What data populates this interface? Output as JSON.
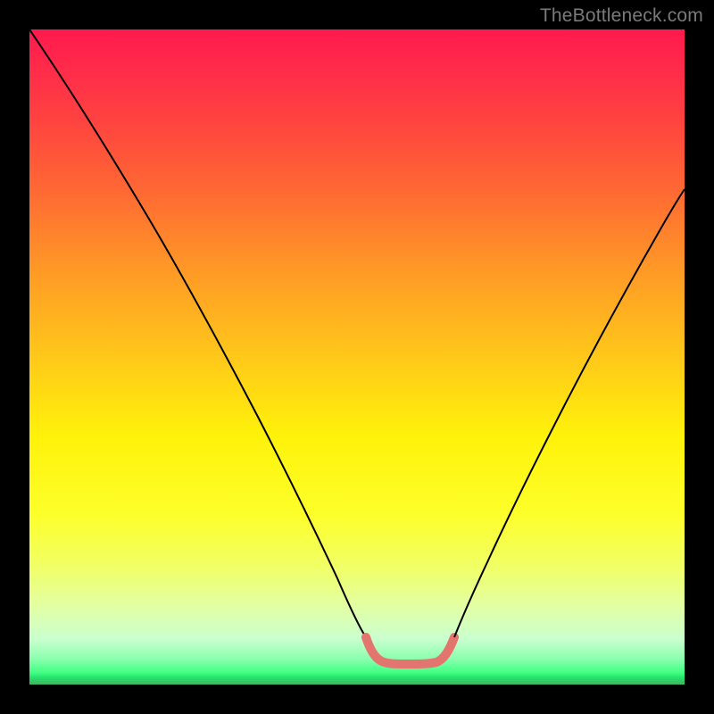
{
  "watermark": "TheBottleneck.com",
  "chart_data": {
    "type": "line",
    "title": "",
    "xlabel": "",
    "ylabel": "",
    "x_range_normalized": [
      0,
      1
    ],
    "y_range_normalized": [
      0,
      1
    ],
    "note": "Axis values are not labeled in the image; coordinates below are normalized to the plot-area where (0,0) is top-left and (1,1) is bottom-right.",
    "series": [
      {
        "name": "left-arm",
        "color": "#000000",
        "stroke_width": 2,
        "points_xy": [
          [
            0.0,
            0.0
          ],
          [
            0.06,
            0.09
          ],
          [
            0.12,
            0.185
          ],
          [
            0.18,
            0.285
          ],
          [
            0.24,
            0.39
          ],
          [
            0.3,
            0.5
          ],
          [
            0.35,
            0.595
          ],
          [
            0.4,
            0.69
          ],
          [
            0.44,
            0.77
          ],
          [
            0.47,
            0.838
          ],
          [
            0.498,
            0.898
          ],
          [
            0.514,
            0.928
          ]
        ]
      },
      {
        "name": "flat-bottom-pink",
        "color": "#e4746e",
        "stroke_width": 10,
        "stroke_linecap": "round",
        "points_xy": [
          [
            0.514,
            0.928
          ],
          [
            0.522,
            0.948
          ],
          [
            0.534,
            0.962
          ],
          [
            0.548,
            0.966
          ],
          [
            0.575,
            0.966
          ],
          [
            0.603,
            0.966
          ],
          [
            0.627,
            0.962
          ],
          [
            0.639,
            0.948
          ],
          [
            0.648,
            0.928
          ]
        ]
      },
      {
        "name": "right-arm",
        "color": "#000000",
        "stroke_width": 2,
        "points_xy": [
          [
            0.648,
            0.928
          ],
          [
            0.662,
            0.898
          ],
          [
            0.688,
            0.842
          ],
          [
            0.72,
            0.774
          ],
          [
            0.76,
            0.69
          ],
          [
            0.808,
            0.594
          ],
          [
            0.86,
            0.494
          ],
          [
            0.912,
            0.398
          ],
          [
            0.96,
            0.312
          ],
          [
            1.0,
            0.244
          ]
        ]
      }
    ],
    "background_gradient_stops": [
      {
        "pos": 0.0,
        "color": "#ff1a4d"
      },
      {
        "pos": 0.25,
        "color": "#ff6a33"
      },
      {
        "pos": 0.5,
        "color": "#ffc81a"
      },
      {
        "pos": 0.74,
        "color": "#fdff2a"
      },
      {
        "pos": 0.93,
        "color": "#caffcf"
      },
      {
        "pos": 1.0,
        "color": "#44b25b"
      }
    ]
  }
}
